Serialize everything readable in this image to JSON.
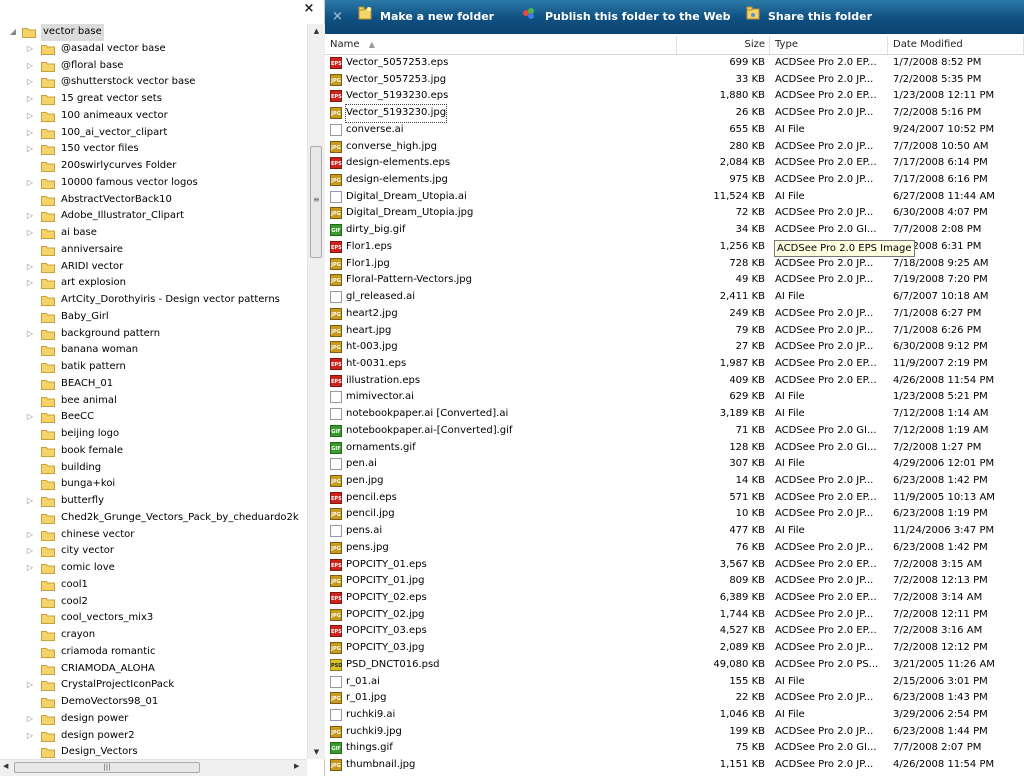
{
  "tree": {
    "close_glyph": "×",
    "items": [
      {
        "label": "vector base",
        "root": true,
        "expanded": true
      },
      {
        "label": "@asadal vector base",
        "exp": true
      },
      {
        "label": "@floral base",
        "exp": true
      },
      {
        "label": "@shutterstock vector base",
        "exp": true
      },
      {
        "label": "15 great vector sets",
        "exp": true
      },
      {
        "label": "100 animeaux vector",
        "exp": true
      },
      {
        "label": "100_ai_vector_clipart",
        "exp": true
      },
      {
        "label": "150 vector files",
        "exp": true
      },
      {
        "label": "200swirlycurves Folder",
        "exp": false
      },
      {
        "label": "10000 famous vector logos",
        "exp": true
      },
      {
        "label": "AbstractVectorBack10",
        "exp": false
      },
      {
        "label": "Adobe_Illustrator_Clipart",
        "exp": true
      },
      {
        "label": "ai base",
        "exp": true
      },
      {
        "label": "anniversaire",
        "exp": false
      },
      {
        "label": "ARIDI vector",
        "exp": true
      },
      {
        "label": "art explosion",
        "exp": true
      },
      {
        "label": "ArtCity_Dorothyiris - Design vector patterns",
        "exp": false
      },
      {
        "label": "Baby_Girl",
        "exp": false
      },
      {
        "label": "background pattern",
        "exp": true
      },
      {
        "label": "banana woman",
        "exp": false
      },
      {
        "label": "batik pattern",
        "exp": false
      },
      {
        "label": "BEACH_01",
        "exp": false
      },
      {
        "label": "bee animal",
        "exp": false
      },
      {
        "label": "BeeCC",
        "exp": true
      },
      {
        "label": "beijing logo",
        "exp": false
      },
      {
        "label": "book female",
        "exp": false
      },
      {
        "label": "building",
        "exp": false
      },
      {
        "label": "bunga+koi",
        "exp": false
      },
      {
        "label": "butterfly",
        "exp": true
      },
      {
        "label": "Ched2k_Grunge_Vectors_Pack_by_cheduardo2k",
        "exp": false
      },
      {
        "label": "chinese vector",
        "exp": true
      },
      {
        "label": "city vector",
        "exp": true
      },
      {
        "label": "comic love",
        "exp": true
      },
      {
        "label": "cool1",
        "exp": false
      },
      {
        "label": "cool2",
        "exp": false
      },
      {
        "label": "cool_vectors_mix3",
        "exp": false
      },
      {
        "label": "crayon",
        "exp": false
      },
      {
        "label": "criamoda romantic",
        "exp": false
      },
      {
        "label": "CRIAMODA_ALOHA",
        "exp": false
      },
      {
        "label": "CrystalProjectIconPack",
        "exp": true
      },
      {
        "label": "DemoVectors98_01",
        "exp": false
      },
      {
        "label": "design power",
        "exp": true
      },
      {
        "label": "design power2",
        "exp": true
      },
      {
        "label": "Design_Vectors",
        "exp": false
      }
    ]
  },
  "tasks": {
    "close_glyph": "×",
    "new_folder": "Make a new folder",
    "publish": "Publish this folder to the Web",
    "share": "Share this folder"
  },
  "columns": {
    "name": "Name",
    "size": "Size",
    "type": "Type",
    "date": "Date Modified"
  },
  "tooltip": "ACDSee Pro 2.0 EPS Image",
  "files": [
    {
      "icon": "eps",
      "name": "Vector_5057253.eps",
      "size": "699 KB",
      "type": "ACDSee Pro 2.0 EP...",
      "date": "1/7/2008 8:52 PM"
    },
    {
      "icon": "jpg",
      "name": "Vector_5057253.jpg",
      "size": "33 KB",
      "type": "ACDSee Pro 2.0 JP...",
      "date": "7/2/2008 5:35 PM"
    },
    {
      "icon": "eps",
      "name": "Vector_5193230.eps",
      "size": "1,880 KB",
      "type": "ACDSee Pro 2.0 EP...",
      "date": "1/23/2008 12:11 PM"
    },
    {
      "icon": "jpg",
      "name": "Vector_5193230.jpg",
      "size": "26 KB",
      "type": "ACDSee Pro 2.0 JP...",
      "date": "7/2/2008 5:16 PM",
      "focus": true
    },
    {
      "icon": "ai",
      "name": "converse.ai",
      "size": "655 KB",
      "type": "AI File",
      "date": "9/24/2007 10:52 PM"
    },
    {
      "icon": "jpg",
      "name": "converse_high.jpg",
      "size": "280 KB",
      "type": "ACDSee Pro 2.0 JP...",
      "date": "7/7/2008 10:50 AM"
    },
    {
      "icon": "eps",
      "name": "design-elements.eps",
      "size": "2,084 KB",
      "type": "ACDSee Pro 2.0 EP...",
      "date": "7/17/2008 6:14 PM"
    },
    {
      "icon": "jpg",
      "name": "design-elements.jpg",
      "size": "975 KB",
      "type": "ACDSee Pro 2.0 JP...",
      "date": "7/17/2008 6:16 PM"
    },
    {
      "icon": "ai",
      "name": "Digital_Dream_Utopia.ai",
      "size": "11,524 KB",
      "type": "AI File",
      "date": "6/27/2008 11:44 AM"
    },
    {
      "icon": "jpg",
      "name": "Digital_Dream_Utopia.jpg",
      "size": "72 KB",
      "type": "ACDSee Pro 2.0 JP...",
      "date": "6/30/2008 4:07 PM"
    },
    {
      "icon": "gif",
      "name": "dirty_big.gif",
      "size": "34 KB",
      "type": "ACDSee Pro 2.0 GI...",
      "date": "7/7/2008 2:08 PM"
    },
    {
      "icon": "eps",
      "name": "Flor1.eps",
      "size": "1,256 KB",
      "type": "",
      "date": "7/7/2008 6:31 PM"
    },
    {
      "icon": "jpg",
      "name": "Flor1.jpg",
      "size": "728 KB",
      "type": "ACDSee Pro 2.0 JP...",
      "date": "7/18/2008 9:25 AM"
    },
    {
      "icon": "jpg",
      "name": "Floral-Pattern-Vectors.jpg",
      "size": "49 KB",
      "type": "ACDSee Pro 2.0 JP...",
      "date": "7/19/2008 7:20 PM"
    },
    {
      "icon": "ai",
      "name": "gl_released.ai",
      "size": "2,411 KB",
      "type": "AI File",
      "date": "6/7/2007 10:18 AM"
    },
    {
      "icon": "jpg",
      "name": "heart2.jpg",
      "size": "249 KB",
      "type": "ACDSee Pro 2.0 JP...",
      "date": "7/1/2008 6:27 PM"
    },
    {
      "icon": "jpg",
      "name": "heart.jpg",
      "size": "79 KB",
      "type": "ACDSee Pro 2.0 JP...",
      "date": "7/1/2008 6:26 PM"
    },
    {
      "icon": "jpg",
      "name": "ht-003.jpg",
      "size": "27 KB",
      "type": "ACDSee Pro 2.0 JP...",
      "date": "6/30/2008 9:12 PM"
    },
    {
      "icon": "eps",
      "name": "ht-0031.eps",
      "size": "1,987 KB",
      "type": "ACDSee Pro 2.0 EP...",
      "date": "11/9/2007 2:19 PM"
    },
    {
      "icon": "eps",
      "name": "illustration.eps",
      "size": "409 KB",
      "type": "ACDSee Pro 2.0 EP...",
      "date": "4/26/2008 11:54 PM"
    },
    {
      "icon": "ai",
      "name": "mimivector.ai",
      "size": "629 KB",
      "type": "AI File",
      "date": "1/23/2008 5:21 PM"
    },
    {
      "icon": "ai",
      "name": "notebookpaper.ai [Converted].ai",
      "size": "3,189 KB",
      "type": "AI File",
      "date": "7/12/2008 1:14 AM"
    },
    {
      "icon": "gif",
      "name": "notebookpaper.ai-[Converted].gif",
      "size": "71 KB",
      "type": "ACDSee Pro 2.0 GI...",
      "date": "7/12/2008 1:19 AM"
    },
    {
      "icon": "gif",
      "name": "ornaments.gif",
      "size": "128 KB",
      "type": "ACDSee Pro 2.0 GI...",
      "date": "7/2/2008 1:27 PM"
    },
    {
      "icon": "ai",
      "name": "pen.ai",
      "size": "307 KB",
      "type": "AI File",
      "date": "4/29/2006 12:01 PM"
    },
    {
      "icon": "jpg",
      "name": "pen.jpg",
      "size": "14 KB",
      "type": "ACDSee Pro 2.0 JP...",
      "date": "6/23/2008 1:42 PM"
    },
    {
      "icon": "eps",
      "name": "pencil.eps",
      "size": "571 KB",
      "type": "ACDSee Pro 2.0 EP...",
      "date": "11/9/2005 10:13 AM"
    },
    {
      "icon": "jpg",
      "name": "pencil.jpg",
      "size": "10 KB",
      "type": "ACDSee Pro 2.0 JP...",
      "date": "6/23/2008 1:19 PM"
    },
    {
      "icon": "ai",
      "name": "pens.ai",
      "size": "477 KB",
      "type": "AI File",
      "date": "11/24/2006 3:47 PM"
    },
    {
      "icon": "jpg",
      "name": "pens.jpg",
      "size": "76 KB",
      "type": "ACDSee Pro 2.0 JP...",
      "date": "6/23/2008 1:42 PM"
    },
    {
      "icon": "eps",
      "name": "POPCITY_01.eps",
      "size": "3,567 KB",
      "type": "ACDSee Pro 2.0 EP...",
      "date": "7/2/2008 3:15 AM"
    },
    {
      "icon": "jpg",
      "name": "POPCITY_01.jpg",
      "size": "809 KB",
      "type": "ACDSee Pro 2.0 JP...",
      "date": "7/2/2008 12:13 PM"
    },
    {
      "icon": "eps",
      "name": "POPCITY_02.eps",
      "size": "6,389 KB",
      "type": "ACDSee Pro 2.0 EP...",
      "date": "7/2/2008 3:14 AM"
    },
    {
      "icon": "jpg",
      "name": "POPCITY_02.jpg",
      "size": "1,744 KB",
      "type": "ACDSee Pro 2.0 JP...",
      "date": "7/2/2008 12:11 PM"
    },
    {
      "icon": "eps",
      "name": "POPCITY_03.eps",
      "size": "4,527 KB",
      "type": "ACDSee Pro 2.0 EP...",
      "date": "7/2/2008 3:16 AM"
    },
    {
      "icon": "jpg",
      "name": "POPCITY_03.jpg",
      "size": "2,089 KB",
      "type": "ACDSee Pro 2.0 JP...",
      "date": "7/2/2008 12:12 PM"
    },
    {
      "icon": "psd",
      "name": "PSD_DNCT016.psd",
      "size": "49,080 KB",
      "type": "ACDSee Pro 2.0 PS...",
      "date": "3/21/2005 11:26 AM"
    },
    {
      "icon": "ai",
      "name": "r_01.ai",
      "size": "155 KB",
      "type": "AI File",
      "date": "2/15/2006 3:01 PM"
    },
    {
      "icon": "jpg",
      "name": "r_01.jpg",
      "size": "22 KB",
      "type": "ACDSee Pro 2.0 JP...",
      "date": "6/23/2008 1:43 PM"
    },
    {
      "icon": "ai",
      "name": "ruchki9.ai",
      "size": "1,046 KB",
      "type": "AI File",
      "date": "3/29/2006 2:54 PM"
    },
    {
      "icon": "jpg",
      "name": "ruchki9.jpg",
      "size": "199 KB",
      "type": "ACDSee Pro 2.0 JP...",
      "date": "6/23/2008 1:44 PM"
    },
    {
      "icon": "gif",
      "name": "things.gif",
      "size": "75 KB",
      "type": "ACDSee Pro 2.0 GI...",
      "date": "7/7/2008 2:07 PM"
    },
    {
      "icon": "jpg",
      "name": "thumbnail.jpg",
      "size": "1,151 KB",
      "type": "ACDSee Pro 2.0 JP...",
      "date": "4/26/2008 11:54 PM"
    }
  ],
  "icon_labels": {
    "eps": "EPS",
    "jpg": "JPG",
    "gif": "GIF",
    "psd": "PSD",
    "ai": ""
  }
}
